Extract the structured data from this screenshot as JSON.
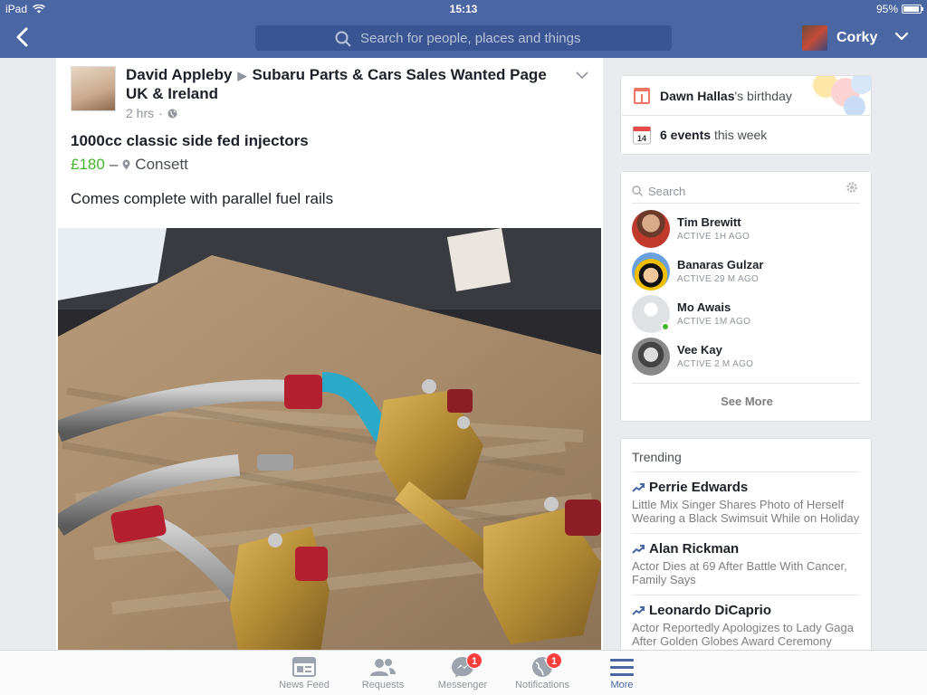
{
  "status_bar": {
    "device": "iPad",
    "time": "15:13",
    "battery": "95%"
  },
  "header": {
    "search_placeholder": "Search for people, places and things",
    "profile_name": "Corky"
  },
  "post": {
    "author": "David Appleby",
    "group": "Subaru Parts & Cars Sales Wanted Page UK & Ireland",
    "time": "2 hrs",
    "title": "1000cc classic side fed injectors",
    "price": "£180",
    "price_separator": "–",
    "location": "Consett",
    "description": "Comes complete with parallel fuel rails"
  },
  "events": {
    "birthday_name": "Dawn Hallas",
    "birthday_suffix": "'s birthday",
    "calendar_day": "14",
    "events_count": "6 events",
    "events_suffix": "this week"
  },
  "chat": {
    "search_placeholder": "Search",
    "friends": [
      {
        "name": "Tim Brewitt",
        "status": "ACTIVE 1H AGO"
      },
      {
        "name": "Banaras Gulzar",
        "status": "ACTIVE 29 M AGO"
      },
      {
        "name": "Mo Awais",
        "status": "ACTIVE 1M AGO"
      },
      {
        "name": "Vee Kay",
        "status": "ACTIVE 2 M AGO"
      }
    ],
    "see_more": "See More"
  },
  "trending": {
    "title": "Trending",
    "items": [
      {
        "name": "Perrie Edwards",
        "desc": "Little Mix Singer Shares Photo of Herself Wearing a Black Swimsuit While on Holiday"
      },
      {
        "name": "Alan Rickman",
        "desc": "Actor Dies at 69 After Battle With Cancer, Family Says"
      },
      {
        "name": "Leonardo DiCaprio",
        "desc": "Actor Reportedly Apologizes to Lady Gaga After Golden Globes Award Ceremony"
      }
    ]
  },
  "tabs": [
    {
      "label": "News Feed"
    },
    {
      "label": "Requests"
    },
    {
      "label": "Messenger",
      "badge": "1"
    },
    {
      "label": "Notifications",
      "badge": "1"
    },
    {
      "label": "More"
    }
  ],
  "colors": {
    "brand": "#4a66a3",
    "price": "#42b72a",
    "badge": "#fa3e3e"
  }
}
